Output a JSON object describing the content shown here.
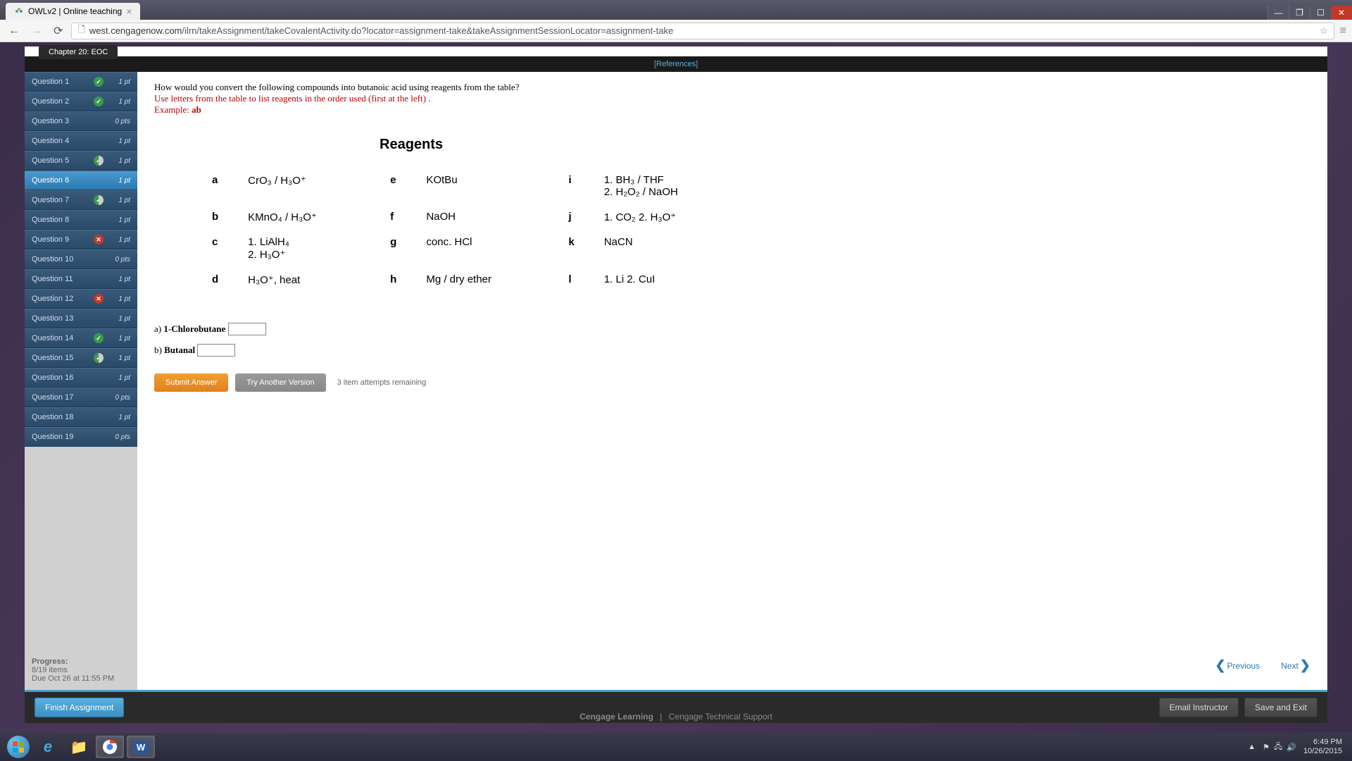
{
  "browser": {
    "tab_title": "OWLv2 | Online teaching",
    "url_domain": "west.cengagenow.com",
    "url_path": "/ilrn/takeAssignment/takeCovalentActivity.do?locator=assignment-take&takeAssignmentSessionLocator=assignment-take"
  },
  "chapter_label": "Chapter 20: EOC",
  "references_label": "[References]",
  "questions": [
    {
      "label": "Question 1",
      "status": "correct",
      "pts": "1 pt"
    },
    {
      "label": "Question 2",
      "status": "correct",
      "pts": "1 pt"
    },
    {
      "label": "Question 3",
      "status": "none",
      "pts": "0 pts"
    },
    {
      "label": "Question 4",
      "status": "none",
      "pts": "1 pt"
    },
    {
      "label": "Question 5",
      "status": "partial",
      "pts": "1 pt"
    },
    {
      "label": "Question 6",
      "status": "none",
      "pts": "1 pt"
    },
    {
      "label": "Question 7",
      "status": "partial",
      "pts": "1 pt"
    },
    {
      "label": "Question 8",
      "status": "none",
      "pts": "1 pt"
    },
    {
      "label": "Question 9",
      "status": "wrong",
      "pts": "1 pt"
    },
    {
      "label": "Question 10",
      "status": "none",
      "pts": "0 pts"
    },
    {
      "label": "Question 11",
      "status": "none",
      "pts": "1 pt"
    },
    {
      "label": "Question 12",
      "status": "wrong",
      "pts": "1 pt"
    },
    {
      "label": "Question 13",
      "status": "none",
      "pts": "1 pt"
    },
    {
      "label": "Question 14",
      "status": "correct",
      "pts": "1 pt"
    },
    {
      "label": "Question 15",
      "status": "partial",
      "pts": "1 pt"
    },
    {
      "label": "Question 16",
      "status": "none",
      "pts": "1 pt"
    },
    {
      "label": "Question 17",
      "status": "none",
      "pts": "0 pts"
    },
    {
      "label": "Question 18",
      "status": "none",
      "pts": "1 pt"
    },
    {
      "label": "Question 19",
      "status": "none",
      "pts": "0 pts"
    }
  ],
  "active_question_index": 5,
  "progress": {
    "label": "Progress:",
    "items": "8/19 items",
    "due": "Due Oct 26 at 11:55 PM"
  },
  "prompt": {
    "line1": "How would you convert the following compounds into butanoic acid using reagents from the table?",
    "line2": "Use letters from the table to list reagents in the order used (first at the left) .",
    "line3_prefix": "Example: ",
    "line3_bold": "ab"
  },
  "reagents_title": "Reagents",
  "reagents": [
    [
      {
        "l": "a",
        "v": "CrO₃ / H₃O⁺"
      },
      {
        "l": "e",
        "v": "KOtBu"
      },
      {
        "l": "i",
        "v": "1. BH₃ / THF\n2. H₂O₂ / NaOH"
      }
    ],
    [
      {
        "l": "b",
        "v": "KMnO₄ / H₃O⁺"
      },
      {
        "l": "f",
        "v": "NaOH"
      },
      {
        "l": "j",
        "v": "1. CO₂  2. H₃O⁺"
      }
    ],
    [
      {
        "l": "c",
        "v": "1. LiAlH₄\n2. H₃O⁺"
      },
      {
        "l": "g",
        "v": "conc. HCl"
      },
      {
        "l": "k",
        "v": "NaCN"
      }
    ],
    [
      {
        "l": "d",
        "v": "H₃O⁺, heat"
      },
      {
        "l": "h",
        "v": "Mg / dry ether"
      },
      {
        "l": "l",
        "v": "1. Li   2. CuI"
      }
    ]
  ],
  "answers": [
    {
      "label": "a) ",
      "compound": "1-Chlorobutane"
    },
    {
      "label": "b) ",
      "compound": "Butanal"
    }
  ],
  "buttons": {
    "submit": "Submit Answer",
    "try_another": "Try Another Version",
    "attempts": "3 item attempts remaining",
    "previous": "Previous",
    "next": "Next",
    "finish": "Finish Assignment",
    "email": "Email Instructor",
    "save_exit": "Save and Exit"
  },
  "footer": {
    "brand": "Cengage Learning",
    "support": "Cengage Technical Support"
  },
  "taskbar": {
    "time": "6:49 PM",
    "date": "10/26/2015"
  }
}
